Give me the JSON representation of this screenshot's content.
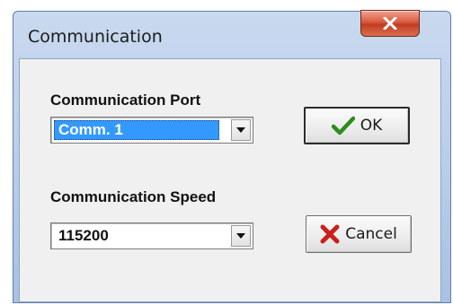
{
  "window": {
    "title": "Communication"
  },
  "port": {
    "label": "Communication Port",
    "selected_value": "Comm. 1"
  },
  "speed": {
    "label": "Communication Speed",
    "selected_value": "115200"
  },
  "buttons": {
    "ok_label": "OK",
    "cancel_label": "Cancel"
  },
  "colors": {
    "selection_highlight": "#3399ff",
    "ok_icon": "#2e8b1e",
    "cancel_icon": "#c8201a",
    "close_button": "#c94a2f"
  },
  "icons": {
    "close": "close-x-icon",
    "ok": "checkmark-icon",
    "cancel": "red-x-icon",
    "dropdown": "dropdown-arrow-icon"
  }
}
